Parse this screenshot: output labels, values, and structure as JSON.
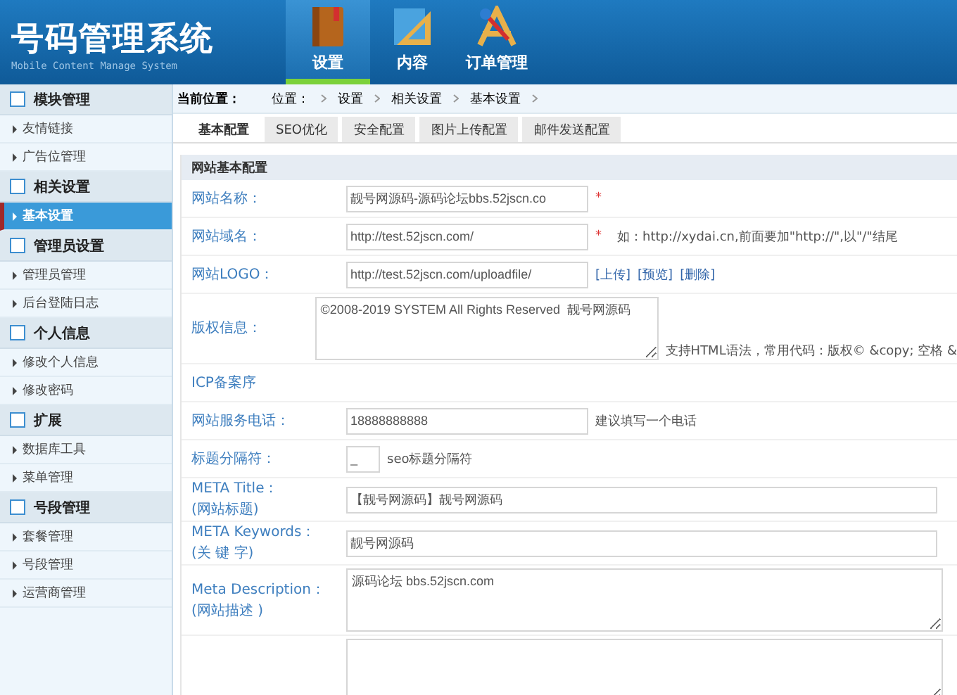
{
  "header": {
    "title": "号码管理系统",
    "subtitle": "Mobile Content Manage System",
    "nav": [
      {
        "label": "设置",
        "selected": true
      },
      {
        "label": "内容",
        "selected": false
      },
      {
        "label": "订单管理",
        "selected": false
      }
    ]
  },
  "sidebar": {
    "sections": [
      {
        "title": "模块管理",
        "items": [
          {
            "label": "友情链接",
            "selected": false
          },
          {
            "label": "广告位管理",
            "selected": false
          }
        ]
      },
      {
        "title": "相关设置",
        "items": [
          {
            "label": "基本设置",
            "selected": true
          }
        ]
      },
      {
        "title": "管理员设置",
        "items": [
          {
            "label": "管理员管理",
            "selected": false
          },
          {
            "label": "后台登陆日志",
            "selected": false
          }
        ]
      },
      {
        "title": "个人信息",
        "items": [
          {
            "label": "修改个人信息",
            "selected": false
          },
          {
            "label": "修改密码",
            "selected": false
          }
        ]
      },
      {
        "title": "扩展",
        "items": [
          {
            "label": "数据库工具",
            "selected": false
          },
          {
            "label": "菜单管理",
            "selected": false
          }
        ]
      },
      {
        "title": "号段管理",
        "items": [
          {
            "label": "套餐管理",
            "selected": false
          },
          {
            "label": "号段管理",
            "selected": false
          },
          {
            "label": "运营商管理",
            "selected": false
          }
        ]
      }
    ]
  },
  "breadcrumb": {
    "label": "当前位置：",
    "items": [
      "位置：",
      "设置",
      "相关设置",
      "基本设置"
    ]
  },
  "tabs": [
    {
      "label": "基本配置",
      "selected": true
    },
    {
      "label": "SEO优化",
      "selected": false
    },
    {
      "label": "安全配置",
      "selected": false
    },
    {
      "label": "图片上传配置",
      "selected": false
    },
    {
      "label": "邮件发送配置",
      "selected": false
    }
  ],
  "form": {
    "title": "网站基本配置",
    "rows": [
      {
        "kind": "input",
        "label": [
          "网站名称："
        ],
        "value": "靓号网源码-源码论坛bbs.52jscn.co",
        "required": "*"
      },
      {
        "kind": "input",
        "label": [
          "网站域名："
        ],
        "value": "http://test.52jscn.com/",
        "required": "*",
        "hint": "如：http://xydai.cn,前面要加\"http://\",以\"/\"结尾"
      },
      {
        "kind": "input",
        "label": [
          "网站LOGO："
        ],
        "value": "http://test.52jscn.com/uploadfile/",
        "links": [
          "[上传]",
          "[预览]",
          "[删除]"
        ]
      },
      {
        "kind": "textarea",
        "label": [
          "版权信息："
        ],
        "value": "©2008-2019 SYSTEM All Rights Reserved  靓号网源码",
        "hint": "支持HTML语法，常用代码：版权© &copy; 空格 &"
      },
      {
        "kind": "none",
        "label": [
          "ICP备案序"
        ]
      },
      {
        "kind": "input",
        "label": [
          "网站服务电话："
        ],
        "value": "18888888888",
        "hint": "建议填写一个电话"
      },
      {
        "kind": "input-short",
        "label": [
          "标题分隔符："
        ],
        "value": "_",
        "hint": "seo标题分隔符"
      },
      {
        "kind": "input-wide",
        "label": [
          "META Title：",
          "(网站标题)"
        ],
        "value": "【靓号网源码】靓号网源码"
      },
      {
        "kind": "input-wide",
        "label": [
          "META Keywords：",
          "(关 键 字)"
        ],
        "value": "靓号网源码"
      },
      {
        "kind": "textarea-wide",
        "label": [
          "Meta Description：",
          "(网站描述 )"
        ],
        "value": "源码论坛 bbs.52jscn.com"
      },
      {
        "kind": "textarea-wide",
        "label": [],
        "value": ""
      }
    ]
  }
}
